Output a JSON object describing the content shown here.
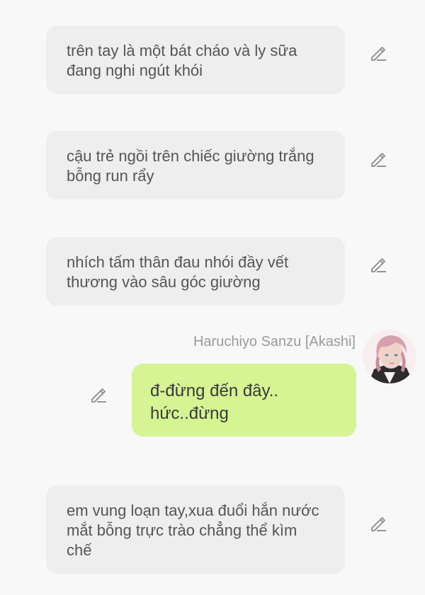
{
  "narration": [
    {
      "text": "trên tay là một bát cháo và ly sữa đang nghi ngút khói"
    },
    {
      "text": "cậu trẻ ngồi trên chiếc giường trắng bỗng run rẩy"
    },
    {
      "text": "nhích tấm thân đau nhói đầy vết thương vào sâu góc giường"
    },
    {
      "text": "em vung loạn tay,xua đuổi hắn nước mắt bỗng trực trào chẳng thể kìm chế"
    }
  ],
  "character_message": {
    "name": "Haruchiyo Sanzu [Akashi]",
    "text": "đ-đừng đến đây.. hức..đừng"
  },
  "colors": {
    "background": "#f8f8f8",
    "narration_bubble": "#eeeeee",
    "character_bubble": "#d6f494",
    "icon": "#8a8a8a"
  },
  "icons": {
    "edit": "pencil-edit-icon",
    "avatar": "character-avatar"
  }
}
